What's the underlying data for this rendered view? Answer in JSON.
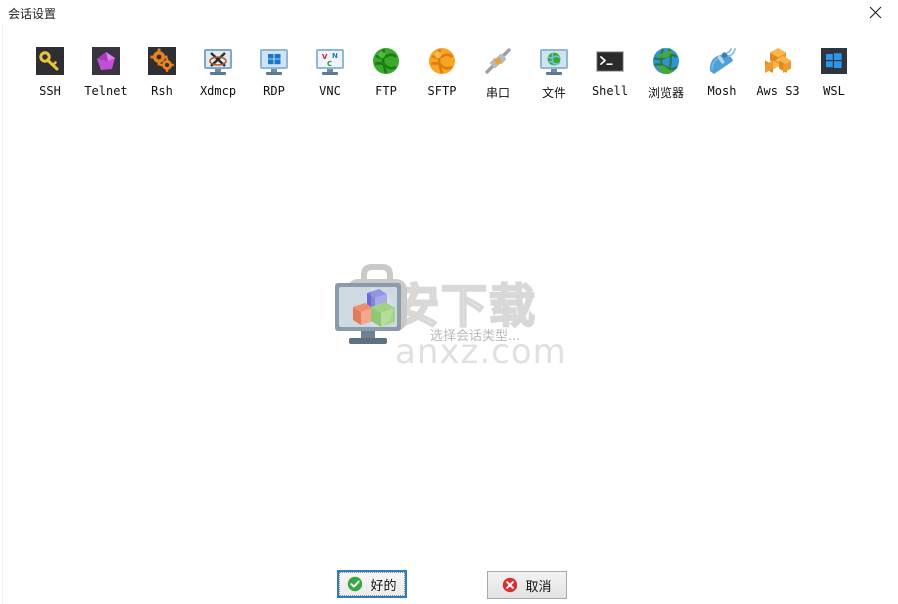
{
  "window": {
    "title": "会话设置",
    "close_icon": "close-icon"
  },
  "toolbar": {
    "items": [
      {
        "label": "SSH",
        "icon": "key-icon",
        "cjk": false
      },
      {
        "label": "Telnet",
        "icon": "purple-gem-icon",
        "cjk": false
      },
      {
        "label": "Rsh",
        "icon": "orange-gears-icon",
        "cjk": false
      },
      {
        "label": "Xdmcp",
        "icon": "monitor-x-icon",
        "cjk": false
      },
      {
        "label": "RDP",
        "icon": "monitor-windows-icon",
        "cjk": false
      },
      {
        "label": "VNC",
        "icon": "monitor-vnc-icon",
        "cjk": false
      },
      {
        "label": "FTP",
        "icon": "green-globe-icon",
        "cjk": false
      },
      {
        "label": "SFTP",
        "icon": "orange-globe-icon",
        "cjk": false
      },
      {
        "label": "串口",
        "icon": "serial-plug-icon",
        "cjk": true
      },
      {
        "label": "文件",
        "icon": "monitor-globe-icon",
        "cjk": true
      },
      {
        "label": "Shell",
        "icon": "terminal-icon",
        "cjk": false
      },
      {
        "label": "浏览器",
        "icon": "blue-globe-icon",
        "cjk": true
      },
      {
        "label": "Mosh",
        "icon": "satellite-dish-icon",
        "cjk": false
      },
      {
        "label": "Aws S3",
        "icon": "orange-cubes-icon",
        "cjk": false
      },
      {
        "label": "WSL",
        "icon": "windows-tile-icon",
        "cjk": false
      }
    ]
  },
  "main": {
    "placeholder_caption": "选择会话类型...",
    "placeholder_art": "monitor-cubes-icon",
    "watermark_top": "安下载",
    "watermark_bottom": "anxz.com"
  },
  "footer": {
    "ok_label": "好的",
    "ok_icon": "green-check-icon",
    "cancel_label": "取消",
    "cancel_icon": "red-x-icon"
  },
  "colors": {
    "focus_border": "#2e7dbd",
    "ok_icon": "#35a745",
    "cancel_icon": "#d63030",
    "caption_text": "#b9b9b9",
    "watermark": "#dedede"
  }
}
